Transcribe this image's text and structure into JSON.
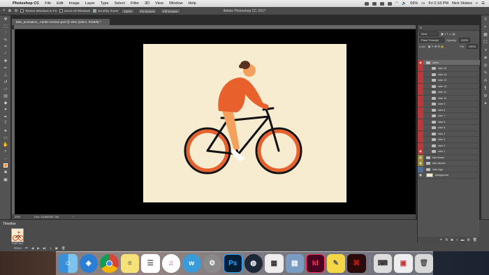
{
  "menubar": {
    "apple": "",
    "app_name": "Photoshop CC",
    "items": [
      "File",
      "Edit",
      "Image",
      "Layer",
      "Type",
      "Select",
      "Filter",
      "3D",
      "View",
      "Window",
      "Help"
    ],
    "battery": "66%",
    "clock": "Fri 2:18 PM",
    "user": "Nick Stokes"
  },
  "options": {
    "resize_windows": "Resize Windows to Fit",
    "zoom_all": "Zoom All Windows",
    "scrubby_zoom": "Scrubby Zoom",
    "zoom_100": "100%",
    "fit_screen": "Fit Screen",
    "fill_screen": "Fill Screen"
  },
  "window_title": "Adobe Photoshop CC 2017",
  "doc_tab": "bike_animation_ Adobe version.psd @ 25% (riders, RGB/8) *",
  "status": {
    "zoom": "25%",
    "doc": "Doc: 23.6M/387.3M"
  },
  "timeline": {
    "title": "Timeline",
    "frame_delay": "0.067 sec",
    "loop": "Once"
  },
  "layers_panel": {
    "kind_label": "Kind",
    "blend_mode": "Pass Through",
    "opacity_label": "Opacity:",
    "opacity_value": "100%",
    "lock_label": "Lock:",
    "fill_label": "Fill:",
    "fill_value": "100%",
    "layers": [
      {
        "name": "riders",
        "type": "folder",
        "selected": true,
        "indent": 0,
        "visible": true
      },
      {
        "name": "rider 16",
        "type": "folder",
        "indent": 1,
        "visible": false
      },
      {
        "name": "rider 14",
        "type": "folder",
        "indent": 1,
        "visible": false
      },
      {
        "name": "rider 13",
        "type": "folder",
        "indent": 1,
        "visible": false
      },
      {
        "name": "rider 12",
        "type": "folder",
        "indent": 1,
        "visible": false
      },
      {
        "name": "rider 11",
        "type": "folder",
        "indent": 1,
        "visible": false
      },
      {
        "name": "rider 10",
        "type": "folder",
        "indent": 1,
        "visible": false
      },
      {
        "name": "rider 9",
        "type": "folder",
        "indent": 1,
        "visible": false
      },
      {
        "name": "rider 8",
        "type": "folder",
        "indent": 1,
        "visible": false
      },
      {
        "name": "rider 7",
        "type": "folder",
        "indent": 1,
        "visible": false
      },
      {
        "name": "rider 6",
        "type": "folder",
        "indent": 1,
        "visible": false
      },
      {
        "name": "rider 5",
        "type": "folder",
        "indent": 1,
        "visible": false
      },
      {
        "name": "rider 4",
        "type": "folder",
        "indent": 1,
        "visible": false
      },
      {
        "name": "rider 3",
        "type": "folder",
        "indent": 1,
        "visible": false
      },
      {
        "name": "rider 2",
        "type": "folder",
        "indent": 1,
        "visible": false
      },
      {
        "name": "rider 1",
        "type": "folder",
        "indent": 1,
        "visible": true
      },
      {
        "name": "bike frame",
        "type": "folder",
        "indent": 0,
        "visible": true
      },
      {
        "name": "bike wheels",
        "type": "folder",
        "indent": 0,
        "visible": true
      },
      {
        "name": "rider legs",
        "type": "folder",
        "indent": 0,
        "visible": false
      },
      {
        "name": "background",
        "type": "image",
        "indent": 0,
        "visible": true
      }
    ],
    "colors": {
      "red": "#b8383b",
      "yellow": "#9a8a3c",
      "green": "#5d8a3f",
      "blue": "#4f6e9a"
    }
  },
  "dock": {
    "apps": [
      "finder-icon",
      "safari-icon",
      "chrome-icon",
      "notes-icon",
      "reminders-icon",
      "itunes-icon",
      "w-icon",
      "settings-icon",
      "photoshop-icon",
      "steam-icon",
      "messenger-icon",
      "preview-icon",
      "indesign-icon",
      "stickies-icon",
      "acrobat-icon",
      "typewriter-icon",
      "photos-icon",
      "trash-icon"
    ],
    "labels": {
      "photoshop": "Ps",
      "indesign": "Id"
    }
  }
}
